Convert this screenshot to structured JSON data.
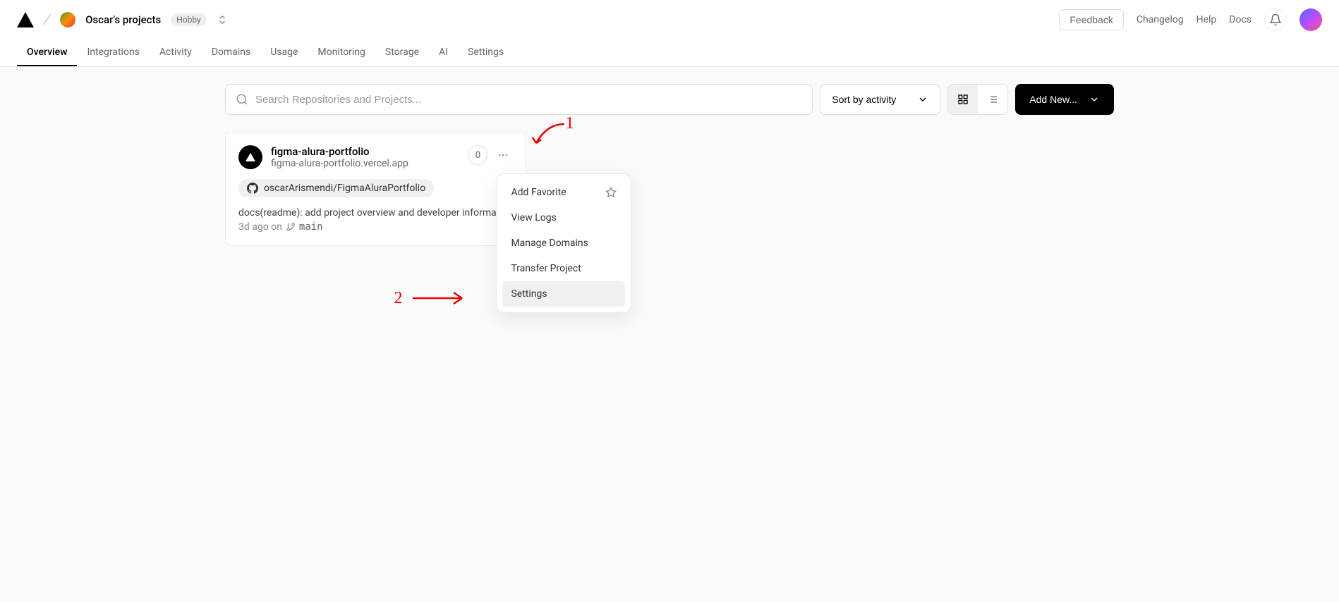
{
  "header": {
    "team_name": "Oscar's projects",
    "plan_badge": "Hobby",
    "feedback": "Feedback",
    "links": [
      "Changelog",
      "Help",
      "Docs"
    ]
  },
  "tabs": [
    "Overview",
    "Integrations",
    "Activity",
    "Domains",
    "Usage",
    "Monitoring",
    "Storage",
    "AI",
    "Settings"
  ],
  "active_tab": "Overview",
  "toolbar": {
    "search_placeholder": "Search Repositories and Projects...",
    "sort_label": "Sort by activity",
    "add_new_label": "Add New..."
  },
  "project": {
    "name": "figma-alura-portfolio",
    "url": "figma-alura-portfolio.vercel.app",
    "repo": "oscarArismendi/FigmaAluraPortfolio",
    "count": "0",
    "commit_message": "docs(readme): add project overview and developer information",
    "commit_age": "3d ago on",
    "branch": "main"
  },
  "dropdown": {
    "items": [
      "Add Favorite",
      "View Logs",
      "Manage Domains",
      "Transfer Project",
      "Settings"
    ],
    "highlighted": "Settings"
  },
  "annotations": {
    "one": "1",
    "two": "2"
  }
}
